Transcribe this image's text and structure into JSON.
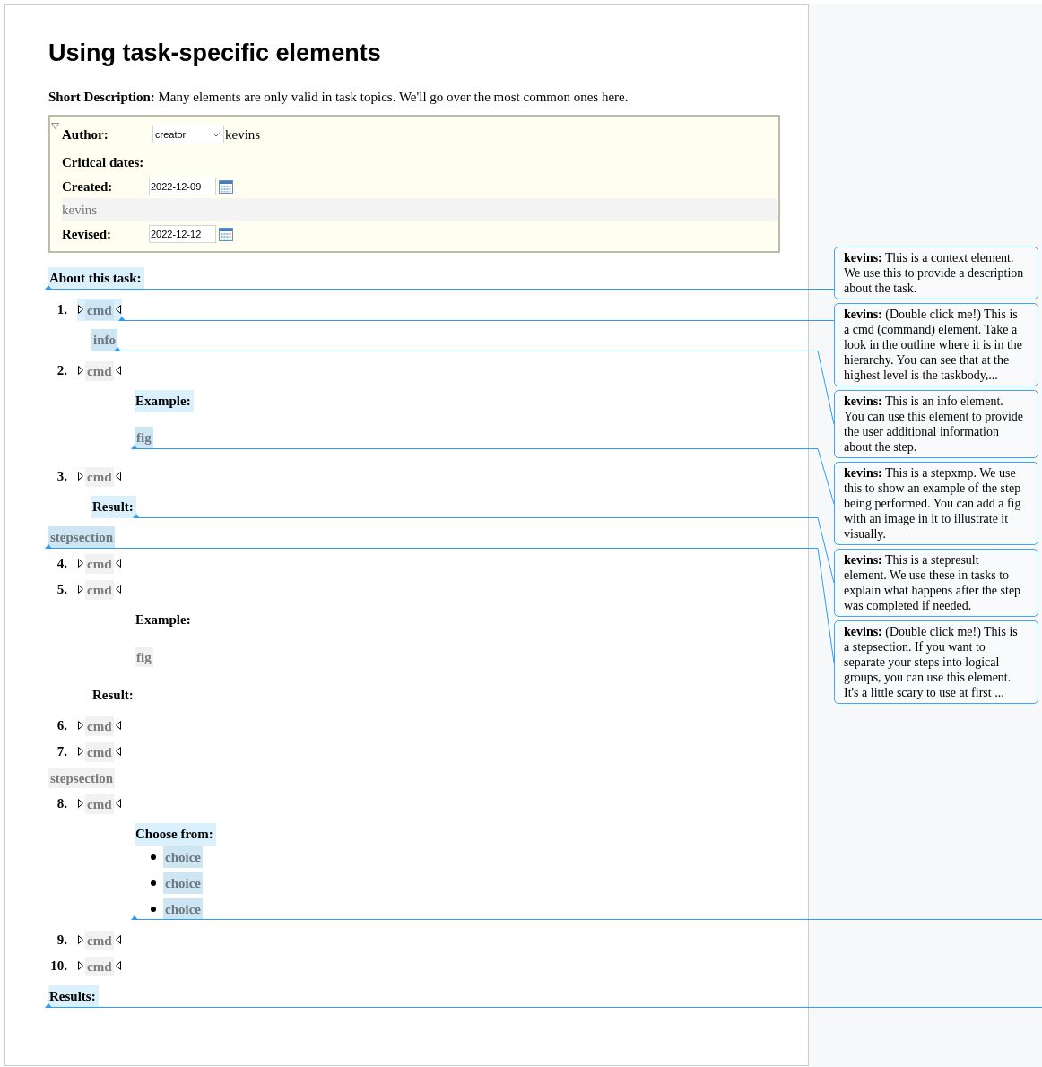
{
  "editor": {
    "title": "Using task-specific elements",
    "short_description": "**Short Description:** Many elements are only valid in task topics. We'll go over the most common ones here.",
    "prolog": {
      "expanded": true,
      "author_label": "Author:",
      "author_type": "creator",
      "author_name": "kevins",
      "critical_dates_label": "Critical dates:",
      "created_label": "Created:",
      "created_date": "2022-12-09",
      "note_author": "kevins",
      "revised_label": "Revised:",
      "revised_date": "2022-12-12"
    },
    "context": {
      "label": "About this task:",
      "commented": true
    },
    "steps": [
      {
        "kind": "step",
        "number": "1.",
        "cmd": {
          "text": "cmd",
          "commented": true
        },
        "parts": [
          {
            "kind": "info",
            "text": "info",
            "commented": true
          }
        ]
      },
      {
        "kind": "step",
        "number": "2.",
        "cmd": {
          "text": "cmd",
          "commented": false
        },
        "parts": [
          {
            "kind": "example",
            "label": "Example:",
            "fig": "fig",
            "commented": true
          }
        ]
      },
      {
        "kind": "step",
        "number": "3.",
        "cmd": {
          "text": "cmd",
          "commented": false
        },
        "parts": [
          {
            "kind": "result",
            "label": "Result:",
            "commented": true
          }
        ]
      },
      {
        "kind": "stepsection",
        "text": "stepsection",
        "commented": true
      },
      {
        "kind": "step",
        "number": "4.",
        "cmd": {
          "text": "cmd",
          "commented": false
        }
      },
      {
        "kind": "step",
        "number": "5.",
        "cmd": {
          "text": "cmd",
          "commented": false
        },
        "parts": [
          {
            "kind": "example",
            "label": "Example:",
            "fig": "fig",
            "commented": false
          },
          {
            "kind": "result",
            "label": "Result:",
            "commented": false
          }
        ]
      },
      {
        "kind": "step",
        "number": "6.",
        "cmd": {
          "text": "cmd",
          "commented": false
        }
      },
      {
        "kind": "step",
        "number": "7.",
        "cmd": {
          "text": "cmd",
          "commented": false
        }
      },
      {
        "kind": "stepsection",
        "text": "stepsection",
        "commented": false
      },
      {
        "kind": "step",
        "number": "8.",
        "cmd": {
          "text": "cmd",
          "commented": false
        },
        "parts": [
          {
            "kind": "choices",
            "label": "Choose from:",
            "items": [
              "choice",
              "choice",
              "choice"
            ],
            "commented": true
          }
        ]
      },
      {
        "kind": "step",
        "number": "9.",
        "cmd": {
          "text": "cmd",
          "commented": false
        }
      },
      {
        "kind": "step",
        "number": "10.",
        "cmd": {
          "text": "cmd",
          "commented": false
        }
      }
    ],
    "results": {
      "label": "Results:",
      "commented": true
    }
  },
  "comments": [
    {
      "lines": [
        "**kevins:** This is a context element.",
        "We use this to provide a description",
        "about the task."
      ]
    },
    {
      "lines": [
        "**kevins:** (Double click me!) This is",
        "a cmd (command) element. Take a",
        "look in the outline where it is in the",
        "hierarchy. You can see that at the",
        "highest level is the taskbody,..."
      ]
    },
    {
      "lines": [
        "**kevins:** This is an info element.",
        "You can use this element to provide",
        "the user additional information",
        "about the step."
      ]
    },
    {
      "lines": [
        "**kevins:** This is a stepxmp. We use",
        "this to show an example of the step",
        "being performed. You can add a fig",
        "with an image in it to illustrate it",
        "visually."
      ]
    },
    {
      "lines": [
        "**kevins:** This is a stepresult",
        "element. We use these in tasks to",
        "explain what happens after the step",
        "was completed if needed."
      ]
    },
    {
      "lines": [
        "**kevins:** (Double click me!) This is",
        "a stepsection. If you want to",
        "separate your steps into logical",
        "groups, you can use this element.",
        "It's a little scary to use at first ..."
      ]
    }
  ]
}
